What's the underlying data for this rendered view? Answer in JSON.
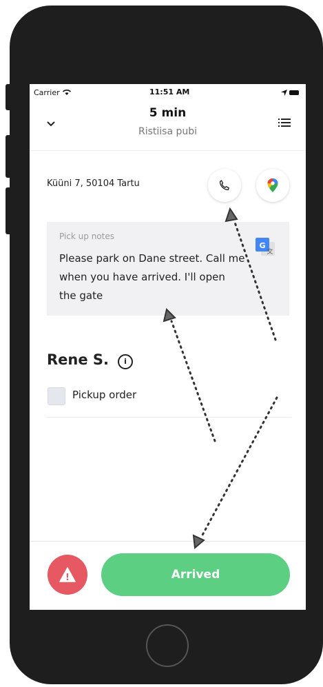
{
  "status_bar": {
    "carrier": "Carrier",
    "time": "11:51 AM"
  },
  "header": {
    "eta": "5 min",
    "venue": "Ristiisa pubi"
  },
  "icons": {
    "back": "chevron-down-icon",
    "menu": "list-icon",
    "phone": "phone-icon",
    "maps": "map-pin-icon",
    "translate": "google-translate-icon",
    "info": "info-icon",
    "warning": "warning-icon"
  },
  "address": "Küüni 7, 50104 Tartu",
  "notes": {
    "label": "Pick up notes",
    "text": "Please park on Dane street. Call me when you have arrived. I'll open the gate"
  },
  "customer": {
    "name": "Rene S.",
    "info_symbol": "i"
  },
  "pickup_order": {
    "label": "Pickup order",
    "checked": false
  },
  "actions": {
    "warning_symbol": "!",
    "arrived_label": "Arrived"
  },
  "colors": {
    "arrived": "#5dcf82",
    "warning": "#e65862",
    "notes_bg": "#f1f1f3",
    "phone_frame": "#1e1e1e"
  }
}
